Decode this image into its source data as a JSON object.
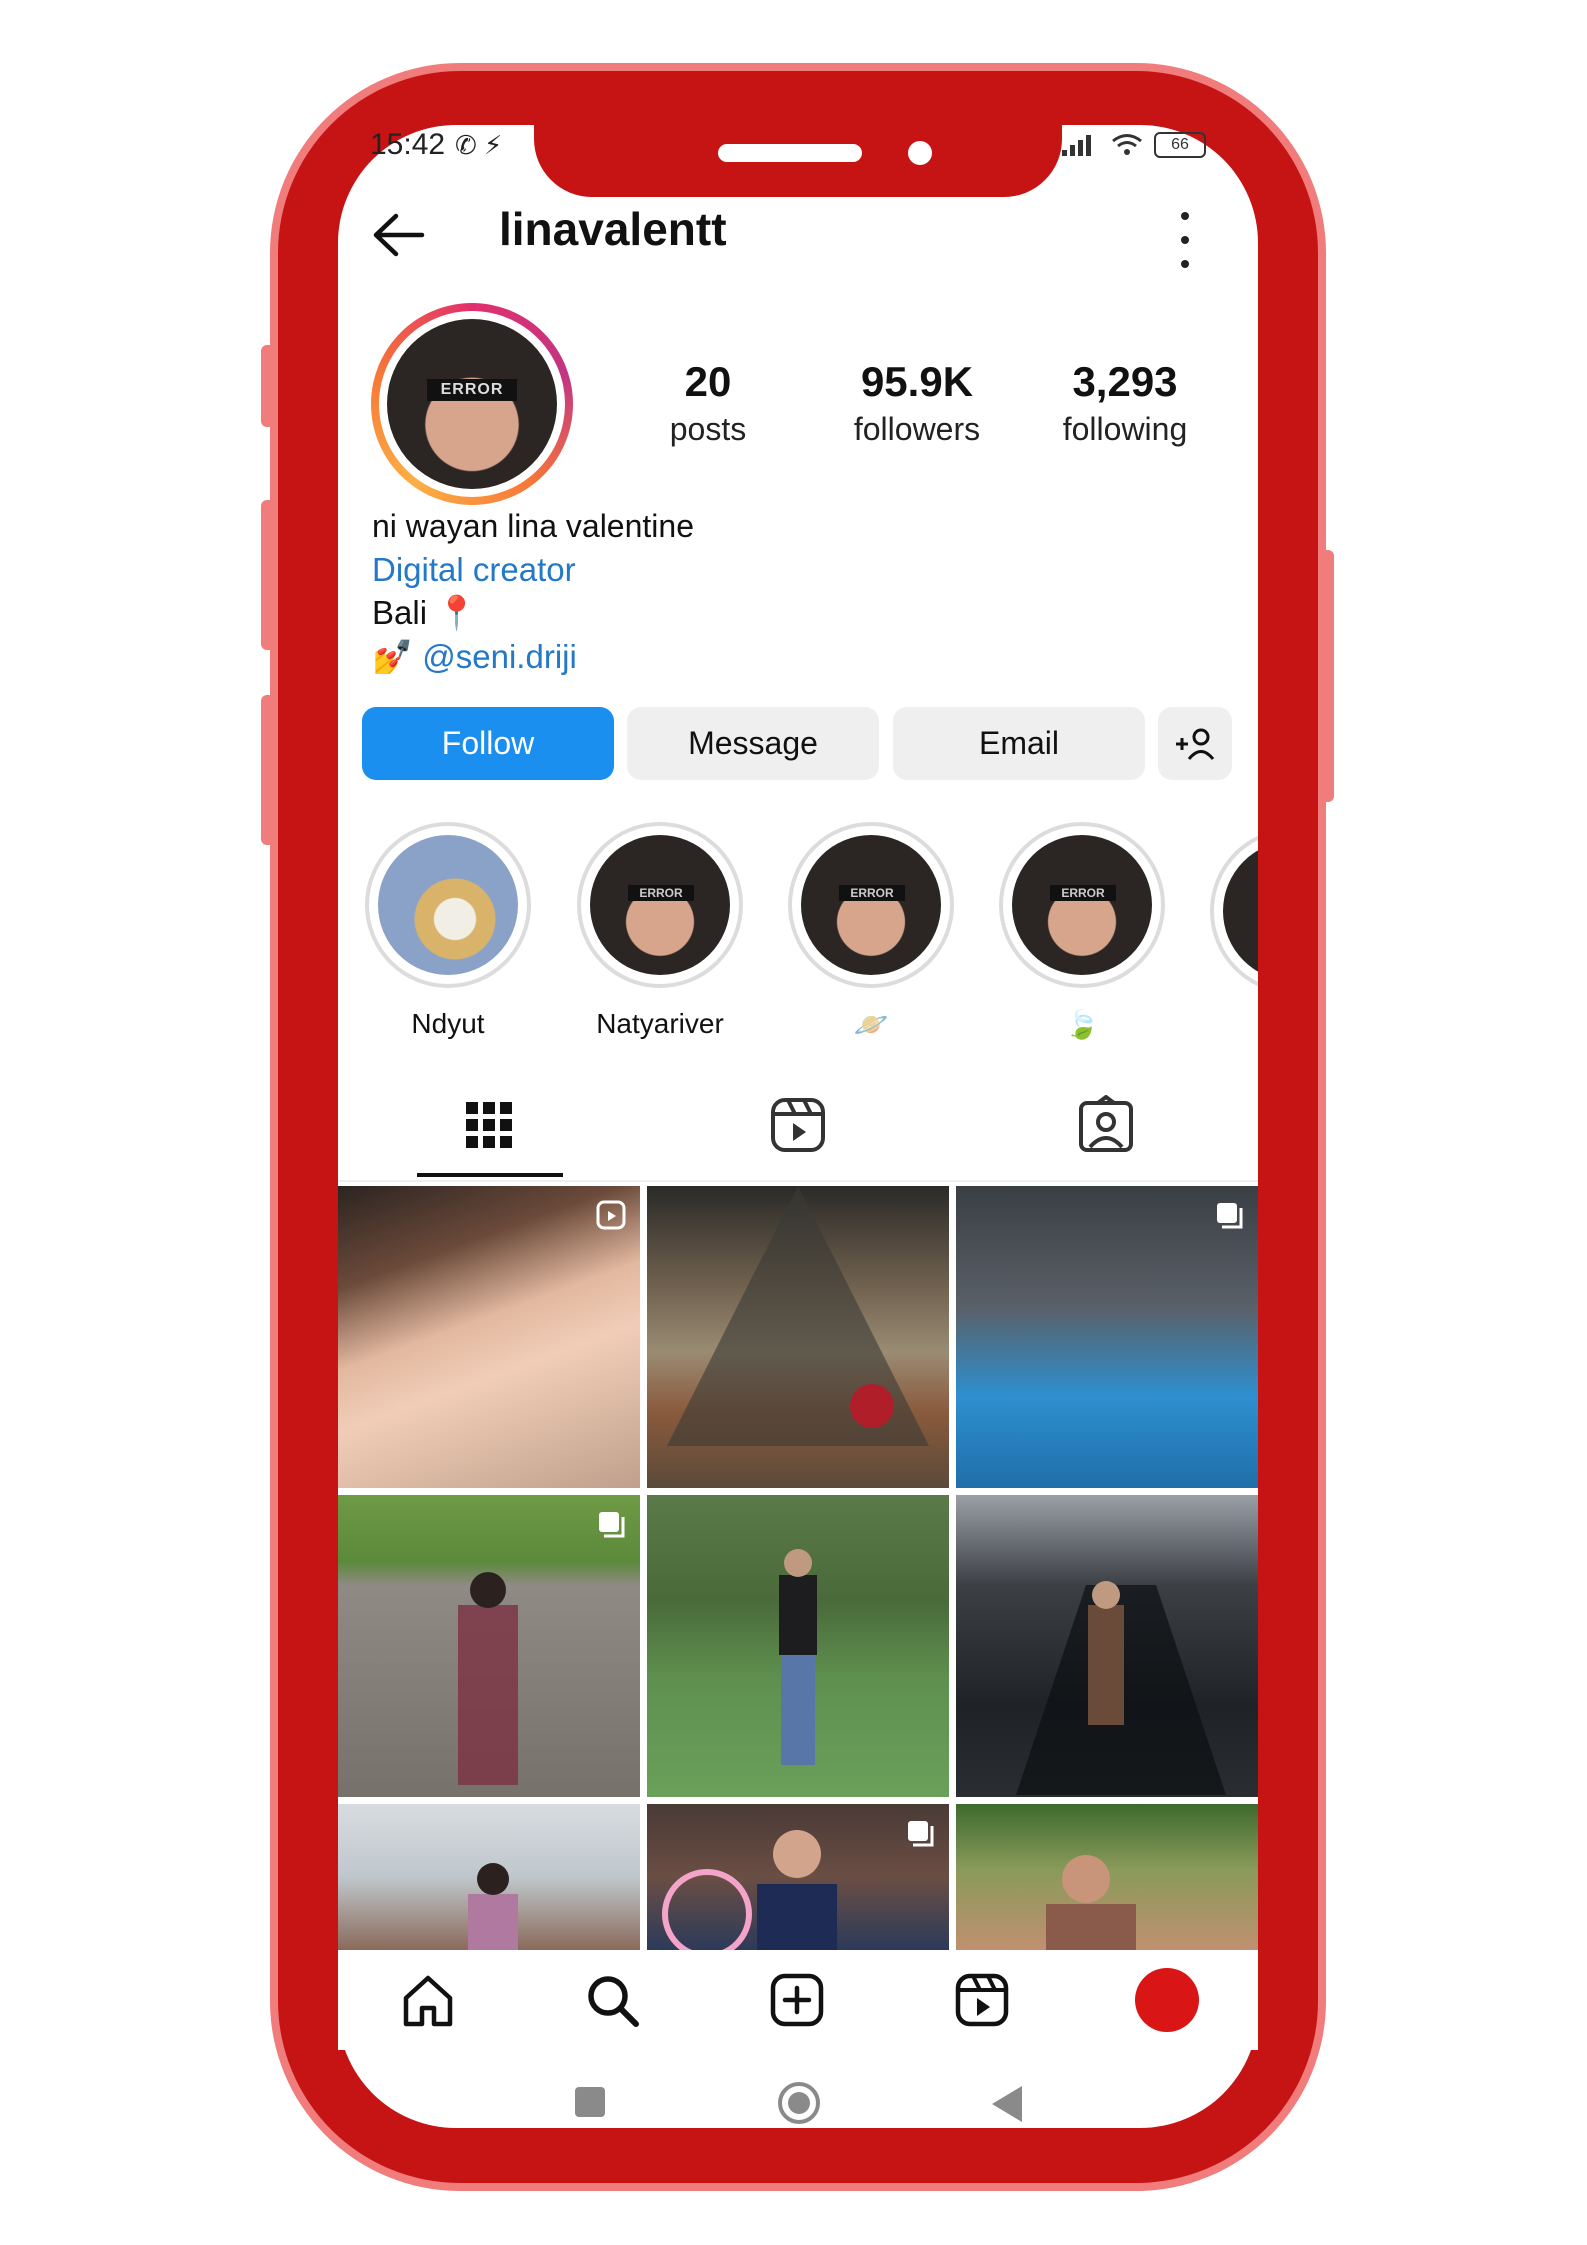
{
  "status": {
    "time": "15:42",
    "battery": "66"
  },
  "header": {
    "username": "linavalentt"
  },
  "stats": [
    {
      "value": "20",
      "label": "posts"
    },
    {
      "value": "95.9K",
      "label": "followers"
    },
    {
      "value": "3,293",
      "label": "following"
    }
  ],
  "avatar": {
    "overlay_text": "ERROR"
  },
  "bio": {
    "name": "ni wayan lina valentine",
    "category": "Digital creator",
    "location": "Bali 📍",
    "link_emoji": "💅",
    "link": "@seni.driji"
  },
  "actions": {
    "follow": "Follow",
    "message": "Message",
    "email": "Email"
  },
  "highlights": [
    {
      "label": "Ndyut",
      "overlay": ""
    },
    {
      "label": "Natyariver",
      "overlay": "ERROR"
    },
    {
      "label": "🪐",
      "overlay": "ERROR"
    },
    {
      "label": "🍃",
      "overlay": "ERROR"
    }
  ],
  "tabs": [
    "grid-icon",
    "reels-icon",
    "tagged-icon"
  ],
  "colors": {
    "frame": "#c61414",
    "frame_edge": "#f07c7c",
    "accent": "#1a8fef",
    "link": "#2478c8"
  }
}
